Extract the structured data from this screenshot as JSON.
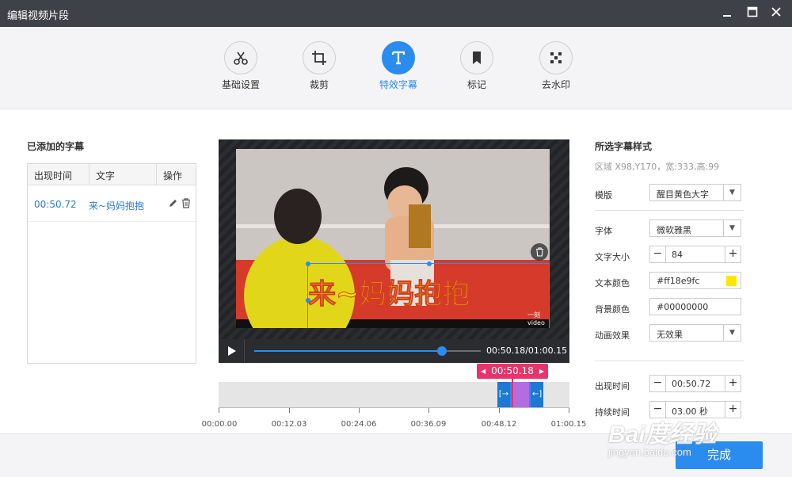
{
  "window": {
    "title": "编辑视频片段"
  },
  "toolbar": {
    "tools": [
      {
        "label": "基础设置",
        "icon": "scissors-icon"
      },
      {
        "label": "裁剪",
        "icon": "crop-icon"
      },
      {
        "label": "特效字幕",
        "icon": "text-t-icon"
      },
      {
        "label": "标记",
        "icon": "bookmark-icon"
      },
      {
        "label": "去水印",
        "icon": "remove-watermark-icon"
      }
    ],
    "active_index": 2
  },
  "subtitles": {
    "title": "已添加的字幕",
    "columns": [
      "出现时间",
      "文字",
      "操作"
    ],
    "rows": [
      {
        "time": "00:50.72",
        "text": "来~妈妈抱抱"
      }
    ]
  },
  "player": {
    "caption": "来~妈妈抱抱",
    "watermark": "一刻video",
    "time": "00:50.18/01:00.15",
    "progress": 0.83,
    "caption_color": "#ff18e9"
  },
  "timeline": {
    "marker": "00:50.18",
    "ticks": [
      "00:00.00",
      "00:12.03",
      "00:24.06",
      "00:36.09",
      "00:48.12",
      "01:00.15"
    ]
  },
  "style_panel": {
    "title": "所选字幕样式",
    "region": "区域 X98,Y170，宽:333,高:99",
    "template_label": "模版",
    "template_value": "醒目黄色大字",
    "font_label": "字体",
    "font_value": "微软雅黑",
    "size_label": "文字大小",
    "size_value": "84",
    "text_color_label": "文本颜色",
    "text_color_value": "#ff18e9fc",
    "text_color_swatch": "#ffe600",
    "bg_color_label": "背景颜色",
    "bg_color_value": "#00000000",
    "anim_label": "动画效果",
    "anim_value": "无效果",
    "appear_label": "出现时间",
    "appear_value": "00:50.72",
    "duration_label": "持续时间",
    "duration_value": "03.00 秒"
  },
  "footer": {
    "done_label": "完成"
  },
  "overlay_watermark": {
    "brand": "Bai度经验",
    "url": "jingyan.baidu.com"
  },
  "colors": {
    "accent": "#2b8cf0",
    "titlebar": "#3f4148",
    "marker": "#e8336b"
  }
}
